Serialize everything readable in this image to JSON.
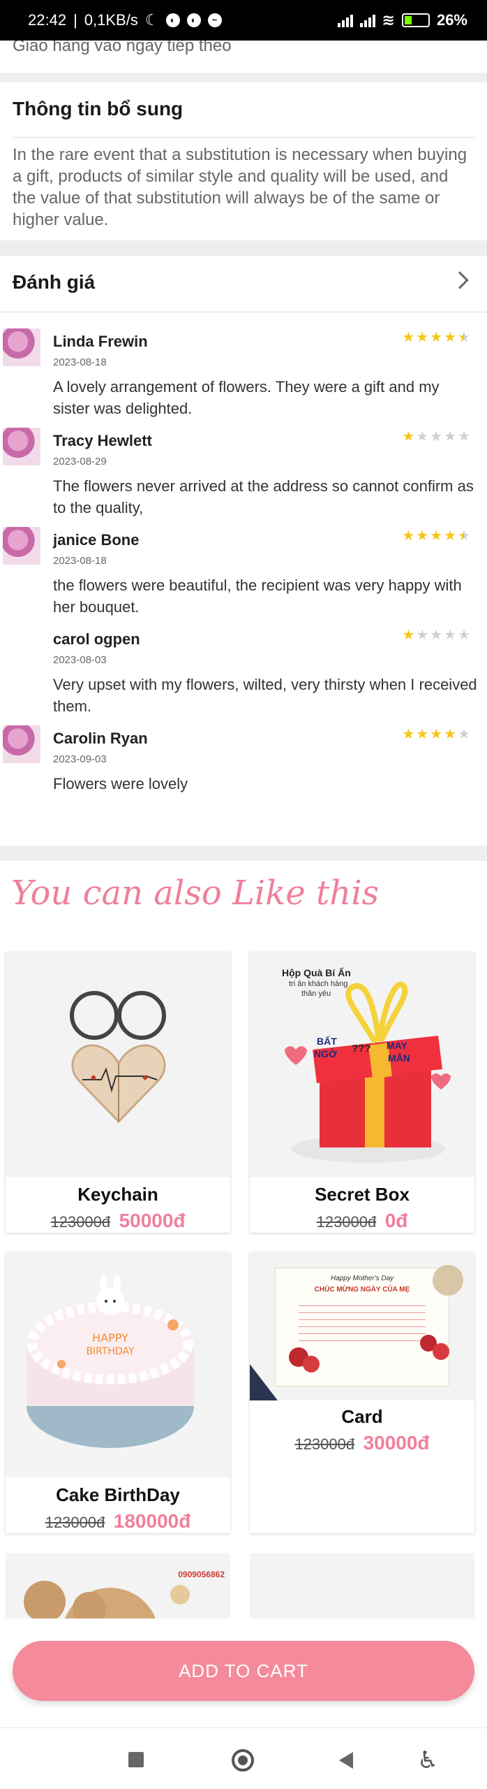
{
  "status_bar": {
    "time": "22:42",
    "speed": "0,1KB/s",
    "battery": "26%"
  },
  "cut_text": "Giao hàng vào ngày tiếp theo",
  "extra_info": {
    "title": "Thông tin bổ sung",
    "text": " In the rare event that a substitution is necessary when buying a gift, products of similar style and quality will be used, and the value of that substitution will always be of the same or higher value."
  },
  "reviews_section": {
    "title": "Đánh giá",
    "reviews": [
      {
        "name": "Linda Frewin",
        "date": "2023-08-18",
        "text": "A lovely arrangement of flowers. They were a gift and my sister was delighted.",
        "rating": 4.5,
        "avatar": true
      },
      {
        "name": "Tracy Hewlett",
        "date": "2023-08-29",
        "text": "The flowers never arrived at the address so cannot confirm as to the quality,",
        "rating": 1,
        "avatar": true
      },
      {
        "name": "janice Bone",
        "date": "2023-08-18",
        "text": "the flowers were beautiful, the recipient was very happy with her bouquet.",
        "rating": 4.5,
        "avatar": true
      },
      {
        "name": "carol ogpen",
        "date": "2023-08-03",
        "text": "Very upset with my flowers, wilted, very thirsty when I received them.",
        "rating": 1,
        "avatar": false
      },
      {
        "name": "Carolin Ryan",
        "date": "2023-09-03",
        "text": "Flowers were lovely",
        "rating": 4,
        "avatar": true
      }
    ]
  },
  "recommend": {
    "title": "You can also Like this",
    "products": [
      {
        "name": "Keychain",
        "old_price": "123000đ",
        "price": "50000đ"
      },
      {
        "name": "Secret Box",
        "old_price": "123000đ",
        "price": "0đ",
        "image_text": [
          "Hộp Quà Bí Ẩn",
          "tri ân khách hàng",
          "thân yêu",
          "BẤT",
          "NGỜ",
          "???",
          "MAY",
          "MẮN"
        ]
      },
      {
        "name": "Cake BirthDay",
        "old_price": "123000đ",
        "price": "180000đ"
      },
      {
        "name": "Card",
        "old_price": "123000đ",
        "price": "30000đ",
        "image_text": [
          "Happy Mother's Day",
          "CHÚC MỪNG NGÀY CỦA MẸ"
        ]
      }
    ],
    "partial_image_text": "0909056862"
  },
  "cart_button": "ADD TO CART",
  "colors": {
    "accent": "#f07f9b",
    "button": "#f58a9a",
    "star": "#f5c518"
  }
}
